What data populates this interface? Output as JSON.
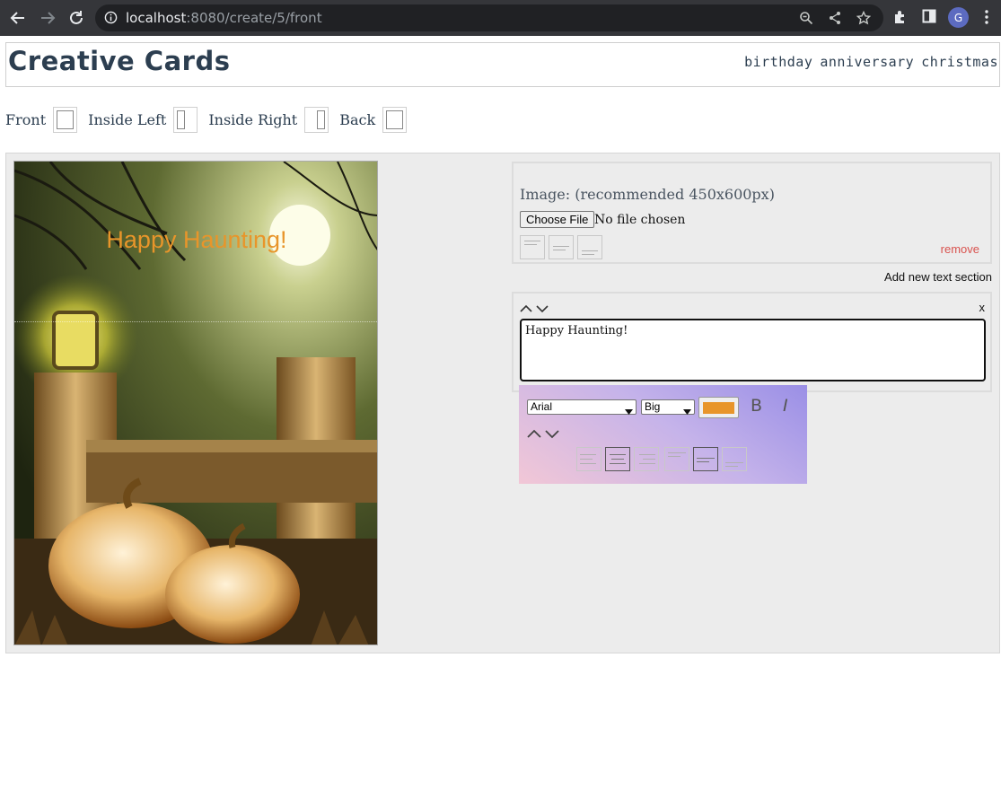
{
  "browser": {
    "url_host": "localhost",
    "url_path": ":8080/create/5/front",
    "profile_initial": "G"
  },
  "site": {
    "title": "Creative Cards",
    "nav": [
      "birthday",
      "anniversary",
      "christmas"
    ]
  },
  "pages": [
    {
      "label": "Front"
    },
    {
      "label": "Inside Left"
    },
    {
      "label": "Inside Right"
    },
    {
      "label": "Back"
    }
  ],
  "card": {
    "text": "Happy Haunting!",
    "text_color": "#e8952a"
  },
  "image_panel": {
    "label": "Image: (recommended 450x600px)",
    "choose_label": "Choose File",
    "no_file": "No file chosen",
    "remove_label": "remove"
  },
  "add_text_label": "Add new text section",
  "text_section": {
    "close_label": "x",
    "content": "Happy Haunting!",
    "font": "Arial",
    "size": "Big",
    "color": "#e8952a",
    "bold_label": "B",
    "italic_label": "I"
  }
}
